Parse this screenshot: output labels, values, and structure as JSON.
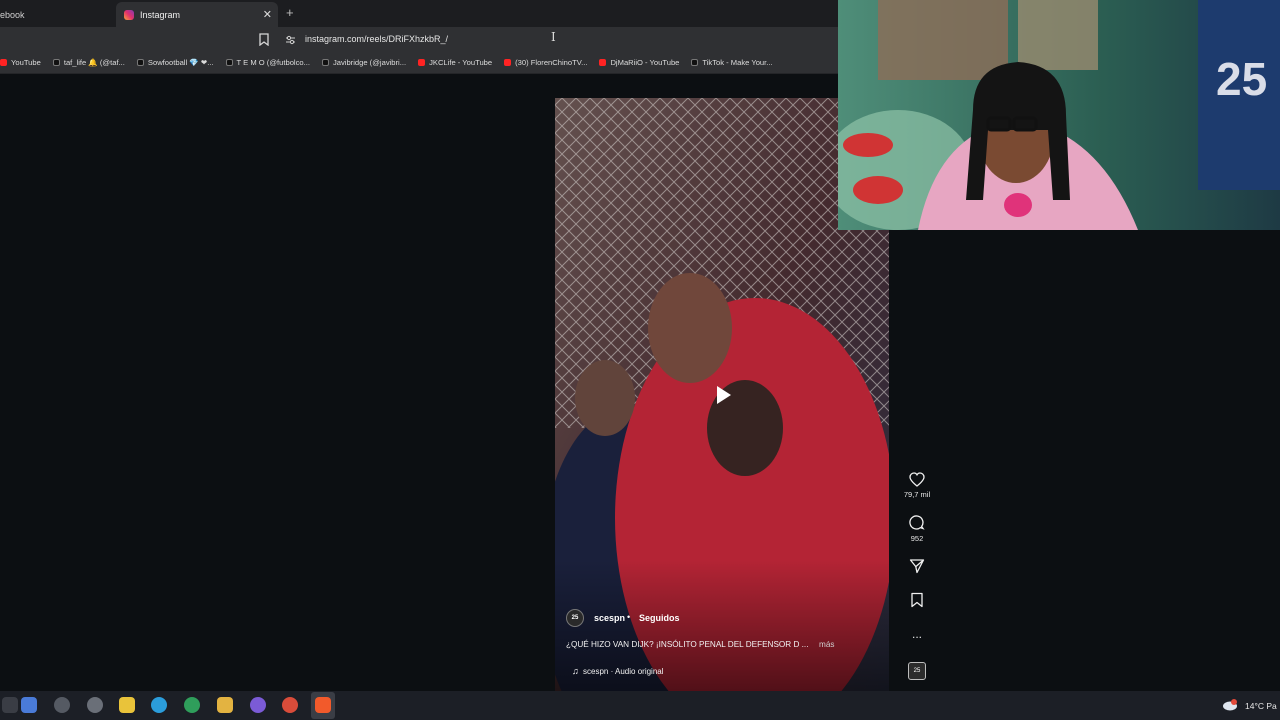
{
  "browser": {
    "tabs": [
      {
        "label": "ebook",
        "active": false
      },
      {
        "label": "Instagram",
        "active": true
      }
    ],
    "url": "instagram.com/reels/DRiFXhzkbR_/",
    "bookmarks": [
      {
        "label": "YouTube",
        "icon": "youtube-icon"
      },
      {
        "label": "taf_life 🔔 (@taf...",
        "icon": "tiktok-icon"
      },
      {
        "label": "Sowfootball 💎 ❤...",
        "icon": "tiktok-icon"
      },
      {
        "label": "T E M O (@futbolco...",
        "icon": "tiktok-icon"
      },
      {
        "label": "Javibridge (@javibri...",
        "icon": "tiktok-icon"
      },
      {
        "label": "JKCLife - YouTube",
        "icon": "youtube-icon"
      },
      {
        "label": "(30) FlorenChinoTV...",
        "icon": "youtube-icon"
      },
      {
        "label": "DjMaRiiO - YouTube",
        "icon": "youtube-icon"
      },
      {
        "label": "TikTok - Make Your...",
        "icon": "tiktok-icon"
      }
    ]
  },
  "reel": {
    "avatar_text": "25",
    "username": "scespn",
    "separator": "•",
    "follow_status": "Seguidos",
    "caption": "¿QUÉ HIZO VAN DIJK? ¡INSÓLITO PENAL DEL DEFENSOR D ...",
    "more": "más",
    "audio": "scespn · Audio original",
    "likes": "79,7 mil",
    "comments": "952",
    "more_options": "...",
    "audio_thumb_text": "25"
  },
  "taskbar": {
    "weather": "14°C  Pa"
  },
  "colors": {
    "jersey_red": "#c4283a",
    "instagram_gradient": [
      "#f9a23a",
      "#e1306c",
      "#833ab4"
    ],
    "chrome_bg": "#2f3033"
  }
}
